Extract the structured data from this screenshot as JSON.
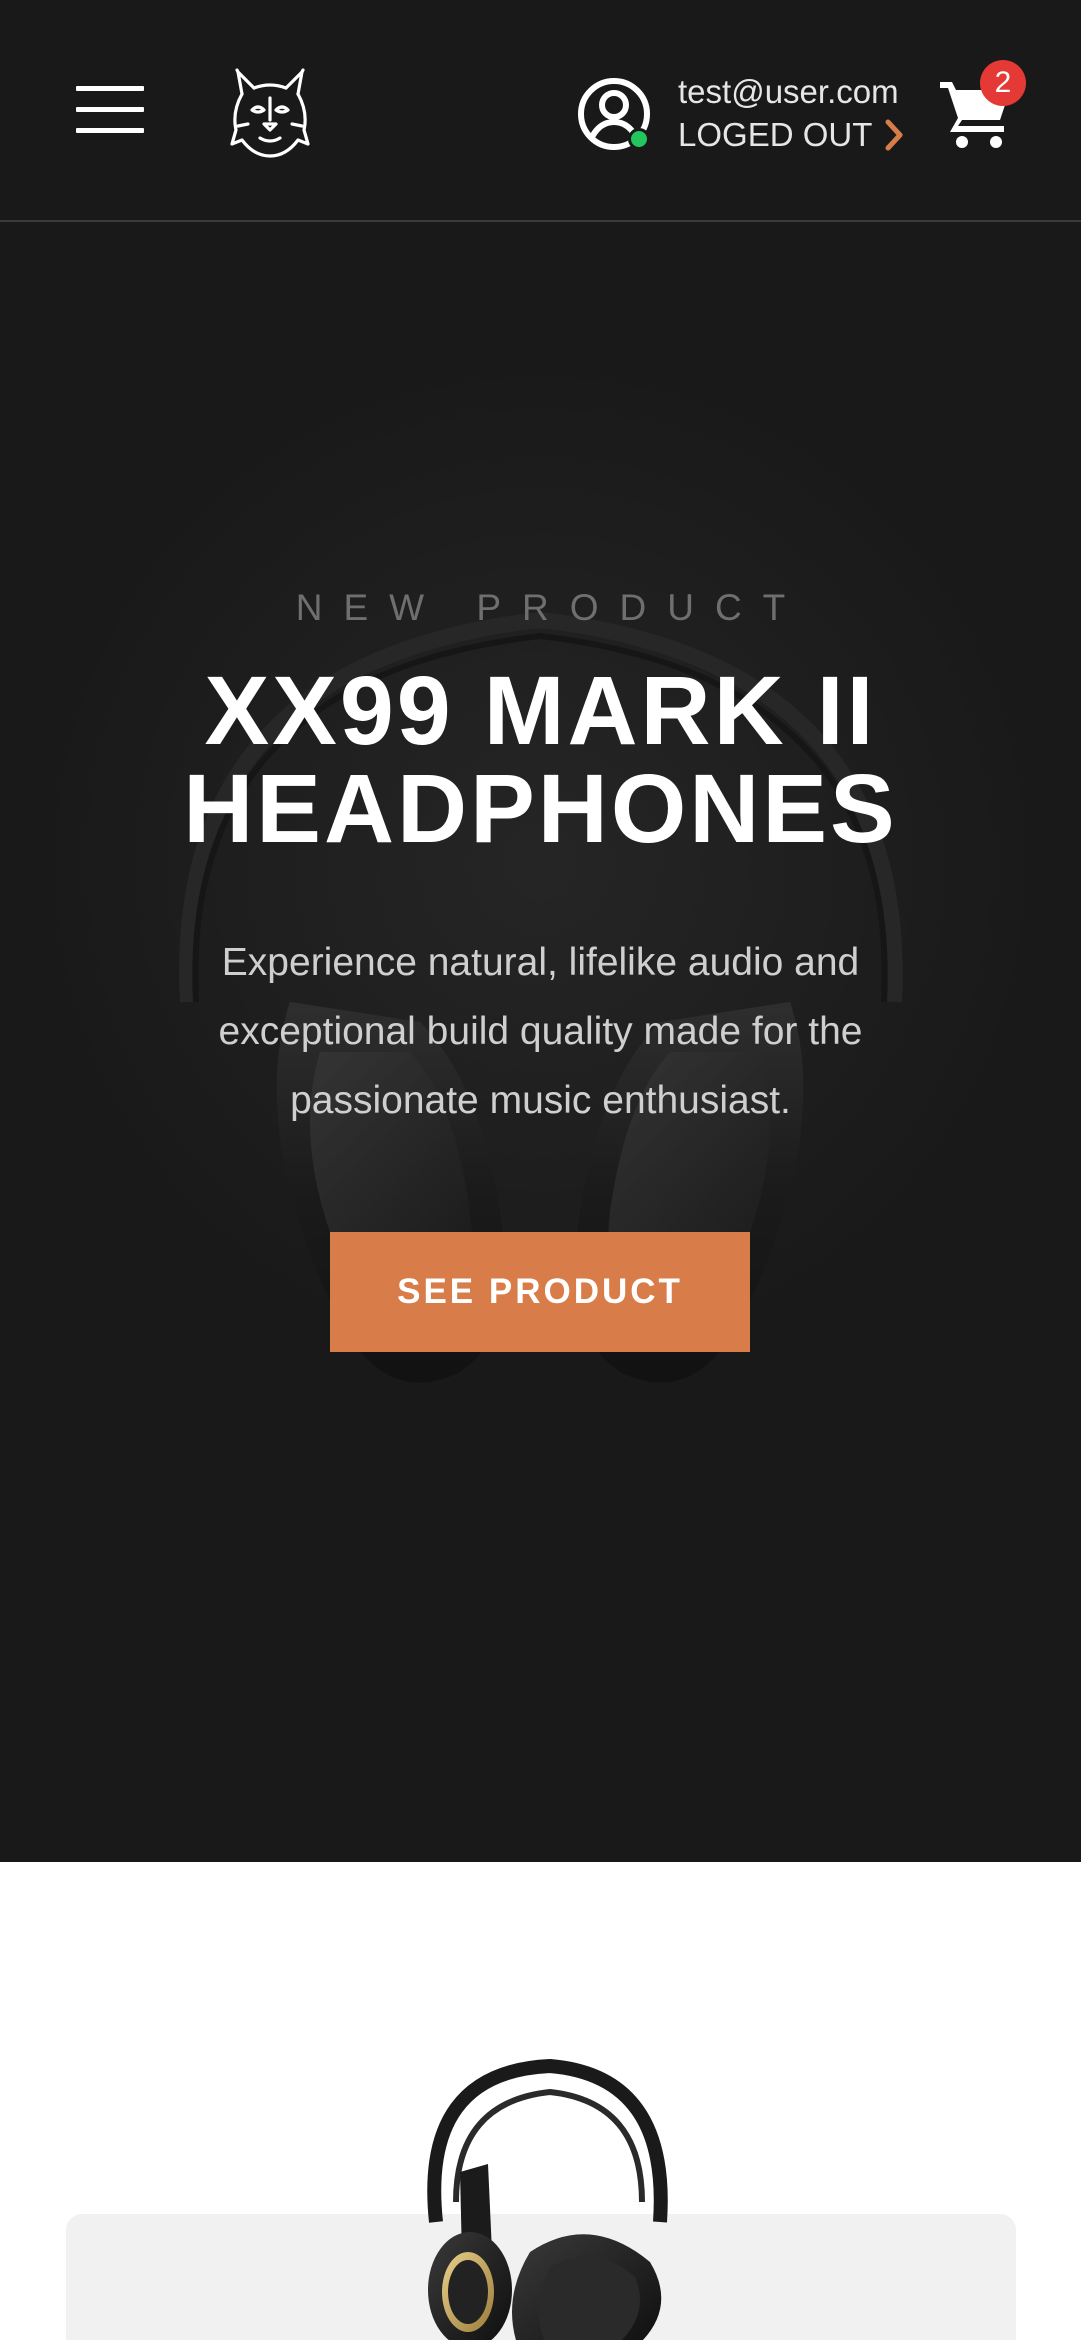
{
  "header": {
    "menu_icon": "hamburger-menu-icon",
    "logo_icon": "lynx-logo-icon",
    "user": {
      "email": "test@user.com",
      "status_label": "LOGED OUT",
      "online_color": "#22c55e"
    },
    "cart": {
      "count": "2",
      "badge_color": "#e53935"
    }
  },
  "hero": {
    "overline": "NEW PRODUCT",
    "title": "XX99 MARK II HEADPHONES",
    "description": "Experience natural, lifelike audio and exceptional build quality made for the passionate music enthusiast.",
    "cta_label": "SEE PRODUCT",
    "accent_color": "#d87d4a",
    "background_color": "#191919"
  },
  "products": {
    "featured_image": "headphones-product-image"
  }
}
